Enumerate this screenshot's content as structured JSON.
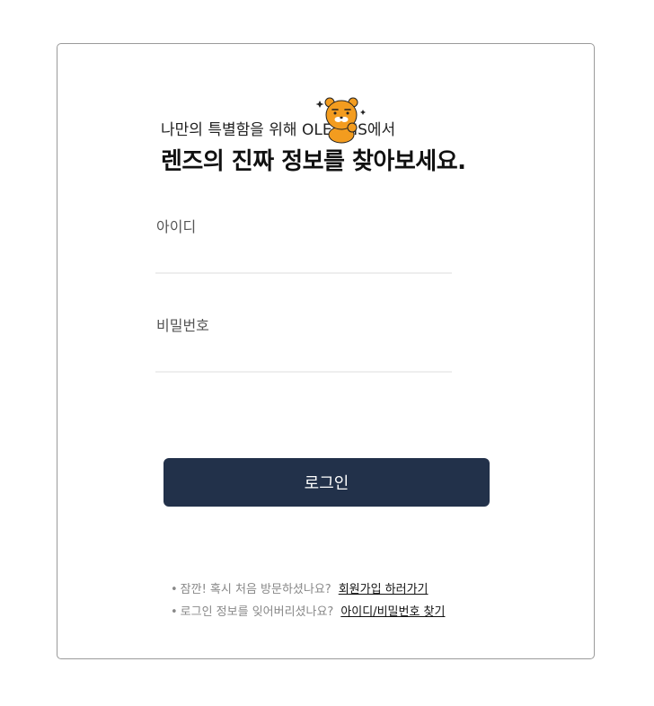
{
  "header": {
    "subtitle": "나만의 특별함을 위해 OLENSIS에서",
    "title": "렌즈의 진짜 정보를 찾아보세요."
  },
  "form": {
    "id_label": "아이디",
    "id_value": "",
    "password_label": "비밀번호",
    "password_value": "",
    "login_label": "로그인"
  },
  "help": {
    "bullet": "•",
    "signup_prompt": "잠깐! 혹시 처음 방문하셨나요?",
    "signup_link": "회원가입 하러가기",
    "find_prompt": "로그인 정보를 잊어버리셨나요?",
    "find_link": "아이디/비밀번호 찾기"
  },
  "colors": {
    "button_bg": "#22314a",
    "mascot": "#f39c1f"
  },
  "icons": {
    "mascot": "ryan-mascot-icon"
  }
}
